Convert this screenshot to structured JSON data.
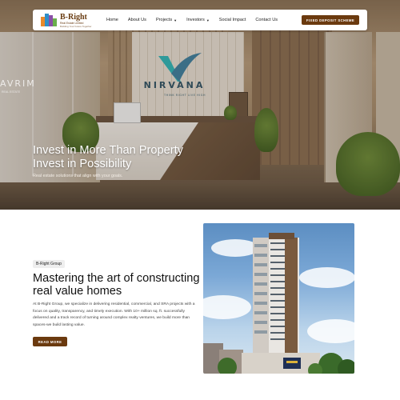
{
  "brand": {
    "name": "B-Right",
    "line1": "Real Estate Limited",
    "line2": "Building Your Future Together"
  },
  "nav": {
    "items": [
      {
        "label": "Home",
        "has_dropdown": false
      },
      {
        "label": "About Us",
        "has_dropdown": false
      },
      {
        "label": "Projects",
        "has_dropdown": true
      },
      {
        "label": "Investors",
        "has_dropdown": true
      },
      {
        "label": "Social Impact",
        "has_dropdown": false
      },
      {
        "label": "Contact Us",
        "has_dropdown": false
      }
    ],
    "cta_label": "FIXED DEPOSIT SCHEME"
  },
  "hero": {
    "signage_name": "NIRVANA",
    "signage_tagline": "THINK RIGHT LIVE HIGH",
    "left_sign": "AVRIM",
    "left_sign_sub": "REAL ESTATE",
    "title_line1": "Invest in More Than Property",
    "title_line2": "Invest in Possibility",
    "subtitle": "Real estate solutions that align with your goals."
  },
  "about": {
    "badge": "B-Right Group",
    "title": "Mastering the art of constructing real value homes",
    "body": "At B-Right Group, we specialize in delivering residential, commercial, and SRA projects with a focus on quality, transparency, and timely execution. With 10+ million sq. ft. successfully delivered and a track record of turning around complex realty ventures, we build more than spaces-we build lasting value.",
    "button_label": "READ MORE"
  },
  "colors": {
    "accent": "#6b3a0f",
    "logo_bars": [
      "#e98a2b",
      "#2e8fc9",
      "#8a4fa6",
      "#6ab04c"
    ]
  }
}
